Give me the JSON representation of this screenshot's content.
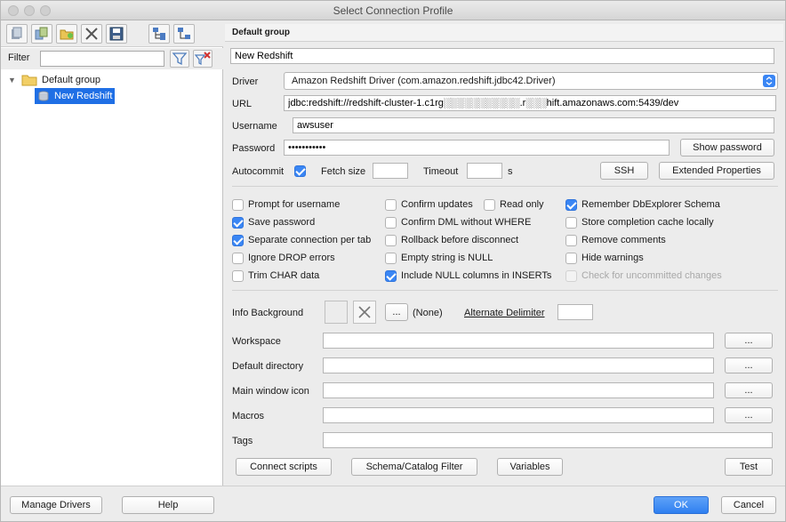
{
  "window": {
    "title": "Select Connection Profile"
  },
  "left": {
    "filter_label": "Filter",
    "filter_value": "",
    "tree": [
      {
        "label": "Default group",
        "type": "folder",
        "expanded": true
      },
      {
        "label": "New Redshift",
        "type": "profile",
        "selected": true
      }
    ]
  },
  "right": {
    "group_title": "Default group",
    "profile_name": "New Redshift",
    "driver_label": "Driver",
    "driver_value": "Amazon Redshift Driver (com.amazon.redshift.jdbc42.Driver)",
    "url_label": "URL",
    "url_value": "jdbc:redshift://redshift-cluster-1.c1rg░░░░░░░░░░░.r░░░hift.amazonaws.com:5439/dev",
    "username_label": "Username",
    "username_value": "awsuser",
    "password_label": "Password",
    "password_value": "•••••••••••",
    "show_password": "Show password",
    "autocommit_label": "Autocommit",
    "autocommit_checked": true,
    "fetch_size_label": "Fetch size",
    "fetch_size_value": "",
    "timeout_label": "Timeout",
    "timeout_value": "",
    "timeout_unit": "s",
    "ssh_button": "SSH",
    "extended_properties_button": "Extended Properties",
    "options": [
      {
        "label": "Prompt for username",
        "checked": false,
        "disabled": false
      },
      {
        "label": "Save password",
        "checked": true,
        "disabled": false
      },
      {
        "label": "Separate connection per tab",
        "checked": true,
        "disabled": false
      },
      {
        "label": "Ignore DROP errors",
        "checked": false,
        "disabled": false
      },
      {
        "label": "Trim CHAR data",
        "checked": false,
        "disabled": false
      },
      {
        "label": "Confirm updates",
        "checked": false,
        "disabled": false
      },
      {
        "label": "Read only",
        "checked": false,
        "disabled": false
      },
      {
        "label": "Confirm DML without WHERE",
        "checked": false,
        "disabled": false
      },
      {
        "label": "Rollback before disconnect",
        "checked": false,
        "disabled": false
      },
      {
        "label": "Empty string is NULL",
        "checked": false,
        "disabled": false
      },
      {
        "label": "Include NULL columns in INSERTs",
        "checked": true,
        "disabled": false
      },
      {
        "label": "Remember DbExplorer Schema",
        "checked": true,
        "disabled": false
      },
      {
        "label": "Store completion cache locally",
        "checked": false,
        "disabled": false
      },
      {
        "label": "Remove comments",
        "checked": false,
        "disabled": false
      },
      {
        "label": "Hide warnings",
        "checked": false,
        "disabled": false
      },
      {
        "label": "Check for uncommitted changes",
        "checked": false,
        "disabled": true
      }
    ],
    "info_background_label": "Info Background",
    "info_background_value": "(None)",
    "ellipsis": "...",
    "alternate_delimiter_label": "Alternate Delimiter",
    "alternate_delimiter_value": "",
    "workspace_label": "Workspace",
    "default_directory_label": "Default directory",
    "main_window_icon_label": "Main window icon",
    "macros_label": "Macros",
    "tags_label": "Tags",
    "connect_scripts_button": "Connect scripts",
    "schema_catalog_filter_button": "Schema/Catalog Filter",
    "variables_button": "Variables",
    "test_button": "Test"
  },
  "bottom": {
    "manage_drivers": "Manage Drivers",
    "help": "Help",
    "ok": "OK",
    "cancel": "Cancel"
  },
  "colors": {
    "accent": "#3a86f4",
    "selection": "#1f6fe5"
  }
}
